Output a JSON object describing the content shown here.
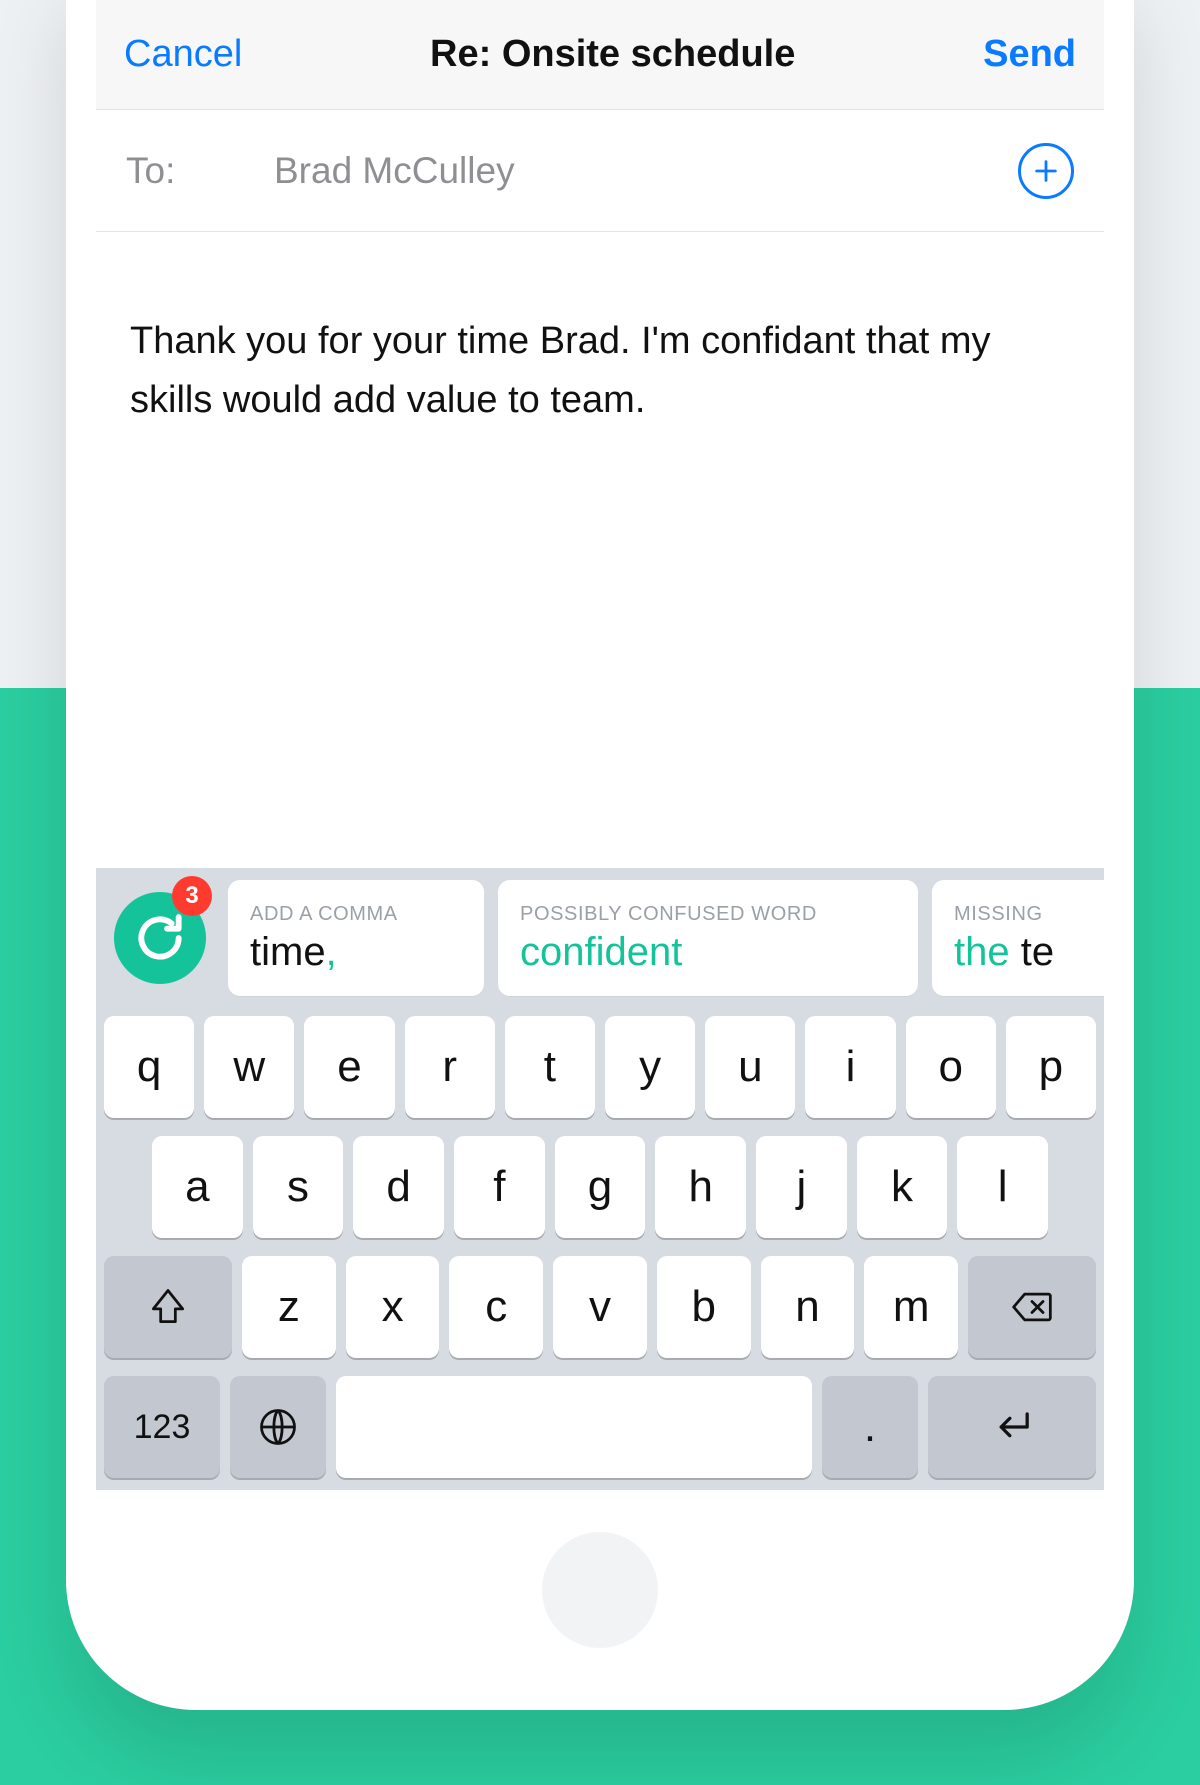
{
  "colors": {
    "accent_blue": "#0a7aff",
    "accent_green": "#15c39a",
    "badge_red": "#ff3b30"
  },
  "nav": {
    "cancel": "Cancel",
    "title": "Re: Onsite schedule",
    "send": "Send"
  },
  "to": {
    "label": "To:",
    "value": "Brad McCulley"
  },
  "body": {
    "text": "Thank you for your time Brad. I'm confidant that my skills would add value to team."
  },
  "grammarly": {
    "badge_count": "3"
  },
  "suggestions": [
    {
      "label": "ADD A COMMA",
      "primary": "time",
      "suffix": ","
    },
    {
      "label": "POSSIBLY CONFUSED WORD",
      "primary": "confident"
    },
    {
      "label": "MISSING",
      "prefix": "the",
      "rest": " te"
    }
  ],
  "keyboard": {
    "row1": [
      "q",
      "w",
      "e",
      "r",
      "t",
      "y",
      "u",
      "i",
      "o",
      "p"
    ],
    "row2": [
      "a",
      "s",
      "d",
      "f",
      "g",
      "h",
      "j",
      "k",
      "l"
    ],
    "row3": [
      "z",
      "x",
      "c",
      "v",
      "b",
      "n",
      "m"
    ],
    "numkey": "123",
    "period": "."
  }
}
